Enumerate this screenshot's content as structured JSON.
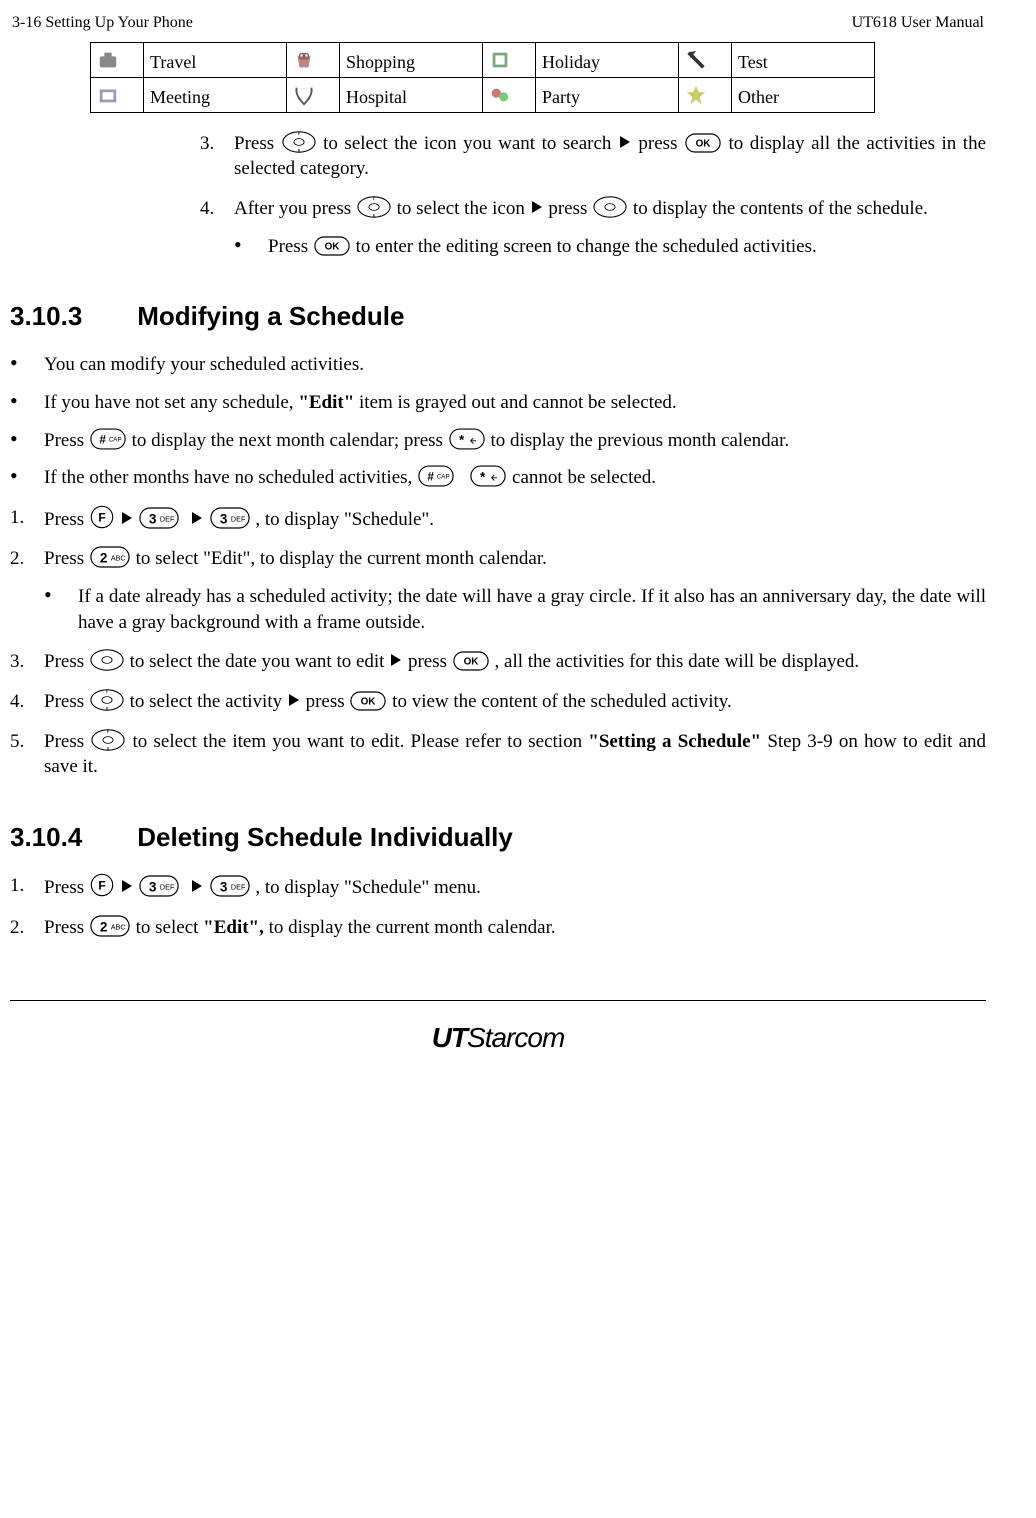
{
  "header": {
    "left": "3-16   Setting Up Your Phone",
    "right": "UT618 User Manual"
  },
  "categories": {
    "row1": [
      "Travel",
      "Shopping",
      "Holiday",
      "Test"
    ],
    "row2": [
      "Meeting",
      "Hospital",
      "Party",
      "Other"
    ]
  },
  "top_steps": {
    "s3": {
      "num": "3.",
      "pre": "Press ",
      "mid1": " to select the icon you want to search ",
      "mid2": " press ",
      "post": " to display all the activities in the selected category."
    },
    "s4": {
      "num": "4.",
      "pre": "After you press ",
      "mid1": " to select the icon ",
      "mid2": " press ",
      "post": " to display the contents of the schedule."
    },
    "s4_sub": {
      "pre": "Press ",
      "post": " to enter the editing screen to change the scheduled activities."
    }
  },
  "sec_3_10_3": {
    "num": "3.10.3",
    "title": "Modifying a Schedule",
    "b1": "You can modify your scheduled activities.",
    "b2": {
      "pre": "If you have not set any schedule, ",
      "bold": "\"Edit\"",
      "post": " item is grayed out and cannot be selected."
    },
    "b3": {
      "pre": "Press ",
      "mid": " to display the next month calendar; press ",
      "post": " to display the previous month calendar."
    },
    "b4": {
      "pre": "If the other months have no scheduled activities, ",
      "post": " cannot be selected."
    },
    "n1": {
      "num": "1.",
      "pre": "Press ",
      "post": ", to display \"Schedule\"."
    },
    "n2": {
      "num": "2.",
      "pre": "Press ",
      "post": " to select \"Edit\", to display the current month calendar."
    },
    "n2_sub": "If a date already has a scheduled activity; the date will have a gray circle. If it also has an anniversary day, the date will have a gray background with a frame outside.",
    "n3": {
      "num": "3.",
      "pre": "Press ",
      "mid1": " to select the date you want to edit ",
      "mid2": " press ",
      "post": ", all the activities for this date will be displayed."
    },
    "n4": {
      "num": "4.",
      "pre": "Press ",
      "mid1": " to select the activity ",
      "mid2": " press ",
      "post": " to view the content of the scheduled activity."
    },
    "n5": {
      "num": "5.",
      "pre": "Press ",
      "mid": " to select the item you want to edit. Please refer to section ",
      "bold": "\"Setting a Schedule\"",
      "post": " Step 3-9 on how to edit and save it."
    }
  },
  "sec_3_10_4": {
    "num": "3.10.4",
    "title": "Deleting Schedule Individually",
    "n1": {
      "num": "1.",
      "pre": "Press ",
      "post": ", to display \"Schedule\" menu."
    },
    "n2": {
      "num": "2.",
      "pre": "Press ",
      "mid": " to select ",
      "bold": "\"Edit\",",
      "post": " to display the current month calendar."
    }
  },
  "footer": {
    "logo1": "UT",
    "logo2": "Starcom"
  }
}
